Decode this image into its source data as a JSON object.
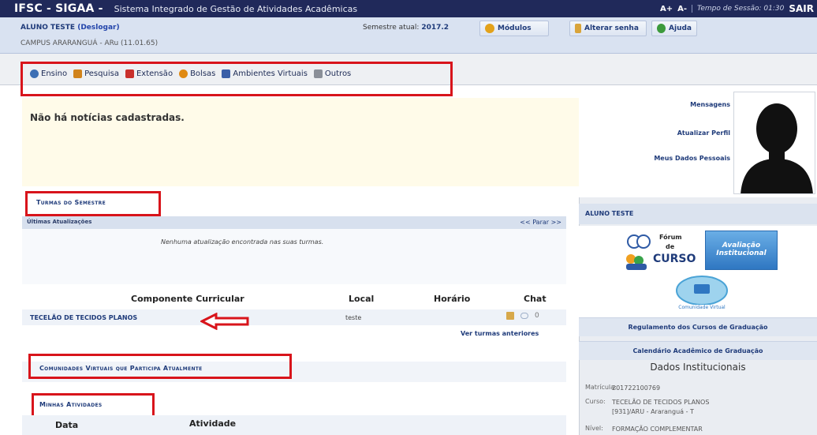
{
  "topbar": {
    "brand": "IFSC - SIGAA -",
    "subtitle": "Sistema Integrado de Gestão de Atividades Acadêmicas",
    "font_increase": "A+",
    "font_decrease": "A-",
    "session_time": "Tempo de Sessão: 01:30",
    "exit": "SAIR"
  },
  "userbar": {
    "user": "ALUNO TESTE",
    "logout_link": "(Deslogar)",
    "campus": "CAMPUS ARARANGUÁ - ARu (11.01.65)",
    "semester_label": "Semestre atual:",
    "semester_value": "2017.2",
    "modules_button": "Módulos",
    "change_password_button": "Alterar senha",
    "help_button": "Ajuda"
  },
  "menu": {
    "items": [
      {
        "label": "Ensino",
        "icon": "graduation-cap-icon",
        "color": "#3d6fb4"
      },
      {
        "label": "Pesquisa",
        "icon": "flask-icon",
        "color": "#d1831b"
      },
      {
        "label": "Extensão",
        "icon": "megaphone-icon",
        "color": "#c9302c"
      },
      {
        "label": "Bolsas",
        "icon": "person-icon",
        "color": "#e08a12"
      },
      {
        "label": "Ambientes Virtuais",
        "icon": "monitor-icon",
        "color": "#3a5fa8"
      },
      {
        "label": "Outros",
        "icon": "folder-icon",
        "color": "#8a8f98"
      }
    ]
  },
  "news": {
    "empty_message": "Não há notícias cadastradas."
  },
  "classes": {
    "section_title": "Turmas do Semestre",
    "updates_title": "Últimas Atualizações",
    "updates_nav": "<< Parar >>",
    "updates_empty": "Nenhuma atualização encontrada nas suas turmas.",
    "columns": {
      "component": "Componente Curricular",
      "local": "Local",
      "schedule": "Horário",
      "chat": "Chat"
    },
    "rows": [
      {
        "component": "TECELÃO DE TECIDOS PLANOS",
        "local": "teste",
        "schedule": "",
        "chat_count": "0"
      }
    ],
    "previous_link": "Ver turmas anteriores"
  },
  "communities": {
    "section_title": "Comunidades Virtuais que Participa Atualmente"
  },
  "activities": {
    "section_title": "Minhas Atividades",
    "columns": {
      "date": "Data",
      "activity": "Atividade"
    }
  },
  "right_panel": {
    "links": {
      "messages": "Mensagens",
      "update_profile": "Atualizar Perfil",
      "personal_data": "Meus Dados Pessoais"
    },
    "student_name": "ALUNO TESTE",
    "forum_logo": {
      "line1": "Fórum",
      "line2": "de",
      "line3": "CURSO"
    },
    "evaluation_logo": {
      "line1": "Avaliação",
      "line2": "Institucional"
    },
    "community_logo": "Comunidade Virtual",
    "regulation_link": "Regulamento dos Cursos de Graduação",
    "calendar_link": "Calendário Acadêmico de Graduação",
    "institutional_title": "Dados Institucionais",
    "institutional": {
      "matricula_label": "Matrícula:",
      "matricula_value": "201722100769",
      "curso_label": "Curso:",
      "curso_value": "TECELÃO DE TECIDOS PLANOS [931]/ARU - Araranguá - T",
      "nivel_label": "Nível:",
      "nivel_value": "FORMAÇÃO COMPLEMENTAR"
    }
  },
  "colors": {
    "topbar": "#20295a",
    "highlight_frame": "#d8141b",
    "link": "#1f3b7a"
  }
}
